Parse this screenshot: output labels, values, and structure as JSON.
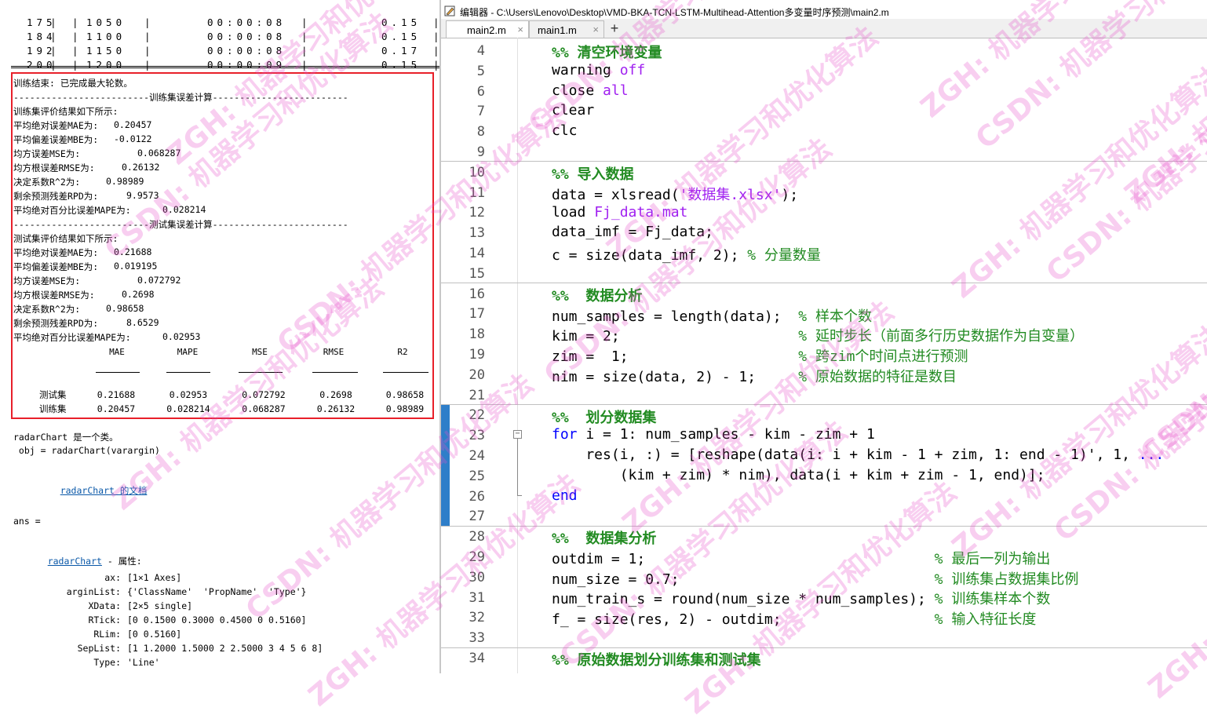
{
  "cmd": {
    "table_rows": [
      {
        "epoch": "175",
        "iter": "1050",
        "time": "00:00:08",
        "value": "0.15"
      },
      {
        "epoch": "184",
        "iter": "1100",
        "time": "00:00:08",
        "value": "0.15"
      },
      {
        "epoch": "192",
        "iter": "1150",
        "time": "00:00:08",
        "value": "0.17"
      },
      {
        "epoch": "200",
        "iter": "1200",
        "time": "00:00:09",
        "value": "0.15"
      }
    ],
    "results": {
      "train_end": "训练结束: 已完成最大轮数。",
      "train_header": "-------------------------训练集误差计算-------------------------",
      "train_intro": "训练集评价结果如下所示:",
      "train_metrics": [
        {
          "label": "平均绝对误差MAE为:",
          "value": "0.20457"
        },
        {
          "label": "平均偏差误差MBE为:",
          "value": "-0.0122"
        },
        {
          "label": "均方误差MSE为:",
          "value": "0.068287"
        },
        {
          "label": "均方根误差RMSE为:",
          "value": "0.26132"
        },
        {
          "label": "决定系数R^2为:",
          "value": "0.98989"
        },
        {
          "label": "剩余预测残差RPD为:",
          "value": "9.9573"
        },
        {
          "label": "平均绝对百分比误差MAPE为:",
          "value": "0.028214"
        }
      ],
      "test_header": "-------------------------测试集误差计算-------------------------",
      "test_intro": "测试集评价结果如下所示:",
      "test_metrics": [
        {
          "label": "平均绝对误差MAE为:",
          "value": "0.21688"
        },
        {
          "label": "平均偏差误差MBE为:",
          "value": "0.019195"
        },
        {
          "label": "均方误差MSE为:",
          "value": "0.072792"
        },
        {
          "label": "均方根误差RMSE为:",
          "value": "0.2698"
        },
        {
          "label": "决定系数R^2为:",
          "value": "0.98658"
        },
        {
          "label": "剩余预测残差RPD为:",
          "value": "8.6529"
        },
        {
          "label": "平均绝对百分比误差MAPE为:",
          "value": "0.02953"
        }
      ],
      "metrics_table": {
        "columns": [
          "MAE",
          "MAPE",
          "MSE",
          "RMSE",
          "R2"
        ],
        "rows": [
          {
            "label": "测试集",
            "values": [
              "0.21688",
              "0.02953",
              "0.072792",
              "0.2698",
              "0.98658"
            ]
          },
          {
            "label": "训练集",
            "values": [
              "0.20457",
              "0.028214",
              "0.068287",
              "0.26132",
              "0.98989"
            ]
          }
        ]
      }
    },
    "after": {
      "class_line": "radarChart 是一个类。",
      "obj_line": " obj = radarChart(varargin)",
      "doc_link": "radarChart",
      "doc_suffix": " 的文档",
      "ans_line": "ans =",
      "props_link": "radarChart",
      "props_suffix": " - 属性:",
      "props": [
        {
          "name": "ax:",
          "value": "[1×1 Axes]"
        },
        {
          "name": "arginList:",
          "value": "{'ClassName'  'PropName'  'Type'}"
        },
        {
          "name": "XData:",
          "value": "[2×5 single]"
        },
        {
          "name": "RTick:",
          "value": "[0 0.1500 0.3000 0.4500 0 0.5160]"
        },
        {
          "name": "RLim:",
          "value": "[0 0.5160]"
        },
        {
          "name": "SepList:",
          "value": "[1 1.2000 1.5000 2 2.5000 3 4 5 6 8]"
        },
        {
          "name": "Type:",
          "value": "'Line'"
        }
      ]
    }
  },
  "editor": {
    "title": "编辑器 - C:\\Users\\Lenovo\\Desktop\\VMD-BKA-TCN-LSTM-Multihead-Attention多变量时序预测\\main2.m",
    "tabs": [
      {
        "label": "main2.m",
        "close": "×"
      },
      {
        "label": "main1.m",
        "close": "×"
      }
    ],
    "add_tab": "+",
    "line_numbers": [
      "4",
      "5",
      "6",
      "7",
      "8",
      "9",
      "10",
      "11",
      "12",
      "13",
      "14",
      "15",
      "16",
      "17",
      "18",
      "19",
      "20",
      "21",
      "22",
      "23",
      "24",
      "25",
      "26",
      "27",
      "28",
      "29",
      "30",
      "31",
      "32",
      "33",
      "34"
    ],
    "code": {
      "l4_sec": "%% 清空环境变量",
      "l5_a": "warning ",
      "l5_b": "off",
      "l6_a": "close ",
      "l6_b": "all",
      "l7": "clear",
      "l8": "clc",
      "l10_sec": "%% 导入数据",
      "l11_a": "data = xlsread(",
      "l11_b": "'数据集.xlsx'",
      "l11_c": ");",
      "l12_a": "load ",
      "l12_b": "Fj_data.mat",
      "l13": "data_imf = Fj_data;",
      "l14_a": "c = size(data_imf, 2); ",
      "l14_b": "% 分量数量",
      "l16_sec": "%%  数据分析",
      "l17_a": "num_samples = length(data);  ",
      "l17_b": "% 样本个数",
      "l18_a": "kim = 2;                     ",
      "l18_b": "% 延时步长（前面多行历史数据作为自变量）",
      "l19_a": "zim =  1;                    ",
      "l19_b": "% 跨zim个时间点进行预测",
      "l20_a": "nim = size(data, 2) - 1;     ",
      "l20_b": "% 原始数据的特征是数目",
      "l22_sec": "%%  划分数据集",
      "l23_a": "for",
      "l23_b": " i = 1: num_samples - kim - zim + 1",
      "l24_a": "    res(i, :) = [reshape(data(i: i + kim - 1 + zim, 1: end - 1)', 1, ",
      "l24_b": "...",
      "l25": "        (kim + zim) * nim), data(i + kim + zim - 1, end)];",
      "l26": "end",
      "l28_sec": "%%  数据集分析",
      "l29_a": "outdim = 1;                                  ",
      "l29_b": "% 最后一列为输出",
      "l30_a": "num_size = 0.7;                              ",
      "l30_b": "% 训练集占数据集比例",
      "l31_a": "num_train_s = round(num_size * num_samples); ",
      "l31_b": "% 训练集样本个数",
      "l32_a": "f_ = size(res, 2) - outdim;                  ",
      "l32_b": "% 输入特征长度",
      "l34_sec": "%% 原始数据划分训练集和测试集"
    }
  },
  "watermark": {
    "texts": [
      "ZGH: 机器学习和优化算法",
      "CSDN: 机器学习和优化算法"
    ],
    "color": "#e650c8"
  }
}
